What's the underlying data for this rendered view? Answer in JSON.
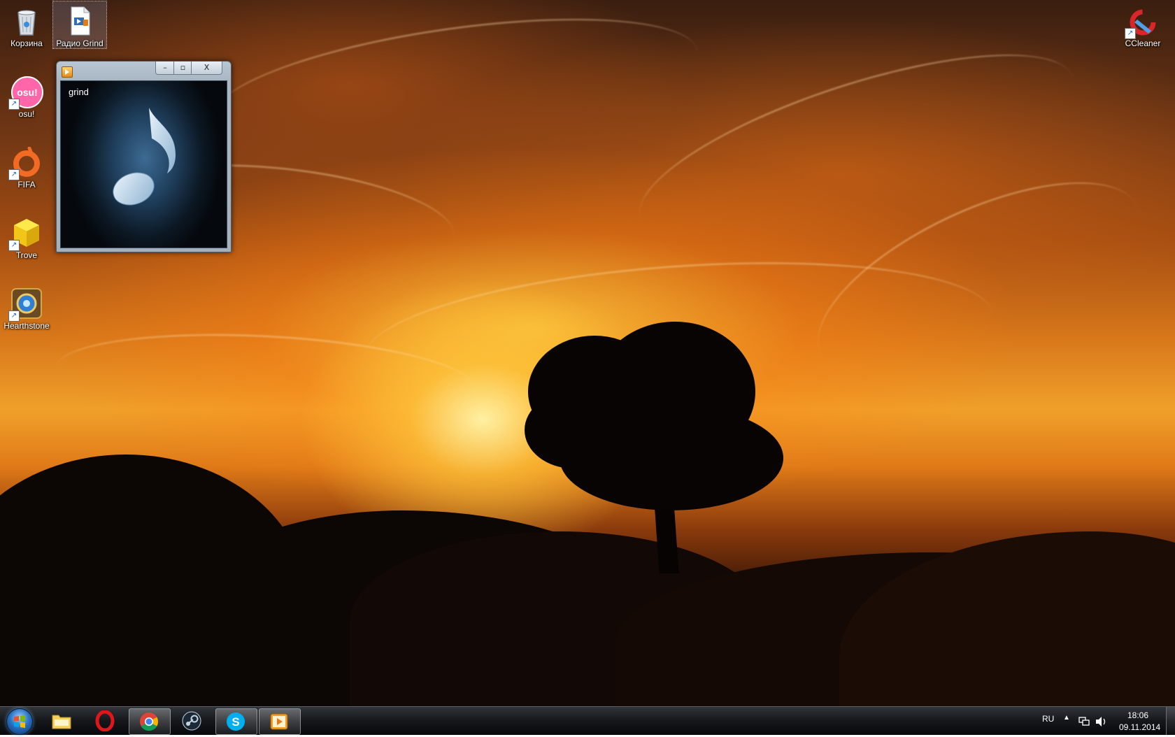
{
  "desktop": {
    "icons": [
      {
        "label": "Корзина",
        "icon": "recycle-bin-icon"
      },
      {
        "label": "Радио Grind",
        "icon": "media-file-icon"
      },
      {
        "label": "osu!",
        "icon": "osu-icon"
      },
      {
        "label": "FIFA",
        "icon": "origin-icon"
      },
      {
        "label": "Trove",
        "icon": "trove-cube-icon"
      },
      {
        "label": "Hearthstone",
        "icon": "hearthstone-icon"
      },
      {
        "label": "CCleaner",
        "icon": "ccleaner-icon"
      }
    ],
    "osu_badge": "osu!"
  },
  "media_window": {
    "track_title": "grind",
    "minimize_glyph": "–",
    "maximize_glyph": "▫",
    "close_glyph": "X"
  },
  "taskbar": {
    "pinned": [
      {
        "name": "windows-explorer",
        "active": false
      },
      {
        "name": "opera",
        "active": false
      },
      {
        "name": "chrome",
        "active": true
      },
      {
        "name": "steam",
        "active": false
      },
      {
        "name": "skype",
        "active": true
      },
      {
        "name": "media-player",
        "active": true
      }
    ],
    "tray": {
      "language": "RU",
      "time": "18:06",
      "date": "09.11.2014"
    }
  },
  "colors": {
    "taskbar_bg": "#101216",
    "window_frame": "#a9b7c5",
    "viewport_glow": "#3d6a93"
  }
}
